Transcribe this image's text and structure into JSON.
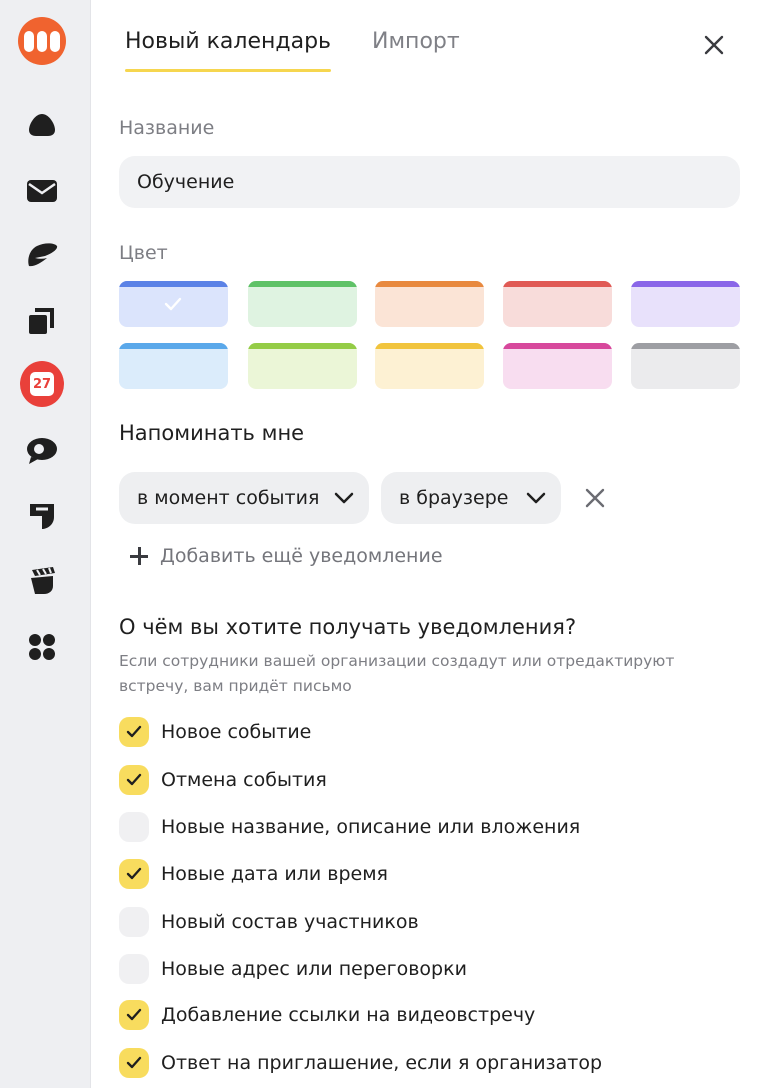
{
  "sidebar": {
    "icons": [
      "logo-icon",
      "cloud-drive-icon",
      "mail-icon",
      "messenger-icon",
      "documents-icon",
      "calendar-icon",
      "chat-icon",
      "forms-icon",
      "notes-icon",
      "all-services-icon"
    ],
    "calendar_day": "27",
    "colors": {
      "logo": "#f0632f",
      "calendar_badge": "#e9403a"
    }
  },
  "tabs": [
    {
      "label": "Новый календарь",
      "active": true
    },
    {
      "label": "Импорт",
      "active": false
    }
  ],
  "form": {
    "name_label": "Название",
    "name_value": "Обучение",
    "color_label": "Цвет",
    "colors": [
      {
        "bar": "#5b82e6",
        "fill": "#dbe4fc",
        "selected": true
      },
      {
        "bar": "#5fc267",
        "fill": "#dff3e1",
        "selected": false
      },
      {
        "bar": "#e8893f",
        "fill": "#fbe4d6",
        "selected": false
      },
      {
        "bar": "#e05a55",
        "fill": "#f8dcda",
        "selected": false
      },
      {
        "bar": "#8a66e8",
        "fill": "#e8e1fb",
        "selected": false
      },
      {
        "bar": "#5aa8ea",
        "fill": "#dbecfb",
        "selected": false
      },
      {
        "bar": "#94cc46",
        "fill": "#ebf6d7",
        "selected": false
      },
      {
        "bar": "#f1c43d",
        "fill": "#fdf1d3",
        "selected": false
      },
      {
        "bar": "#d7489c",
        "fill": "#f8ddf0",
        "selected": false
      },
      {
        "bar": "#9d9ea3",
        "fill": "#ebebed",
        "selected": false
      }
    ],
    "remind_title": "Напоминать мне",
    "remind_when": "в момент события",
    "remind_channel": "в браузере",
    "add_notification": "Добавить ещё уведомление",
    "notify_title": "О чём вы хотите получать уведомления?",
    "notify_desc": "Если сотрудники вашей организации создадут или отредактируют встречу, вам придёт письмо",
    "options": [
      {
        "label": "Новое событие",
        "checked": true
      },
      {
        "label": "Отмена события",
        "checked": true
      },
      {
        "label": "Новые название, описание или вложения",
        "checked": false
      },
      {
        "label": "Новые дата или время",
        "checked": true
      },
      {
        "label": "Новый состав участников",
        "checked": false
      },
      {
        "label": "Новые адрес или переговорки",
        "checked": false
      },
      {
        "label": "Добавление ссылки на видеовстречу",
        "checked": true
      },
      {
        "label": "Ответ на приглашение, если я организатор",
        "checked": true
      }
    ]
  },
  "accent": "#f6d64f"
}
